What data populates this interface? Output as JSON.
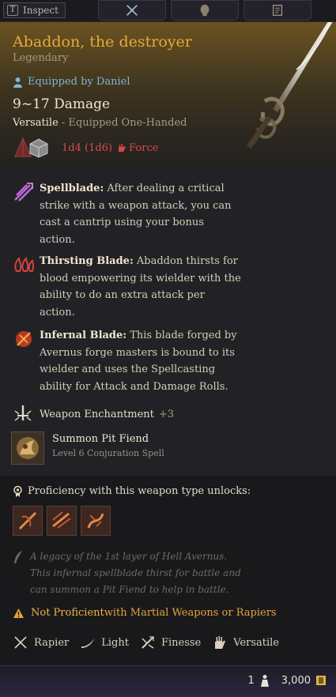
{
  "topbar": {
    "inspect_key": "T",
    "inspect_label": "Inspect",
    "tabs": [
      {
        "icon": "crossed-axes-icon"
      },
      {
        "icon": "character-head-icon"
      },
      {
        "icon": "journal-icon"
      }
    ]
  },
  "item": {
    "name": "Abaddon, the destroyer",
    "rarity": "Legendary",
    "equipped_by": "Equipped by Daniel",
    "damage": "9~17 Damage",
    "handedness_type": "Versatile",
    "handedness_state": " - Equipped One-Handed",
    "extra_damage": "1d4 (1d6)",
    "damage_type": "Force",
    "colors": {
      "title": "#e8a93a",
      "force": "#d84a4a",
      "equipped": "#7fb6d6"
    }
  },
  "passives": [
    {
      "name": "Spellblade:",
      "text": " After dealing a critical strike with a weapon attack, you can cast a cantrip using your bonus action.",
      "icon": "spellblade-icon"
    },
    {
      "name": "Thirsting Blade:",
      "text": " Abaddon thirsts for blood empowering its wielder with the ability to do an extra attack per action.",
      "icon": "thirsting-blade-icon"
    },
    {
      "name": "Infernal Blade:",
      "text": " This blade forged by Avernus forge masters is bound to its wielder and uses the Spellcasting ability for Attack and Damage Rolls.",
      "icon": "infernal-blade-icon"
    }
  ],
  "enchantment": {
    "label": "Weapon Enchantment",
    "value": "+3"
  },
  "spell": {
    "name": "Summon Pit Fiend",
    "level": "Level 6 Conjuration Spell"
  },
  "proficiency": {
    "title": "Proficiency with this weapon type unlocks:",
    "skills": [
      "slash-skill-icon",
      "cleave-skill-icon",
      "flourish-skill-icon"
    ]
  },
  "lore": {
    "line1": "A legacy of the 1st layer of Hell Avernus.",
    "line2": "This infernal spellblade thirst for battle and",
    "line3": "can summon a Pit Fiend to help in battle."
  },
  "warning": {
    "not": "Not Proficient",
    "rest": " with Martial Weapons or Rapiers"
  },
  "properties": [
    {
      "label": "Rapier",
      "icon": "rapier-icon"
    },
    {
      "label": "Light",
      "icon": "light-icon"
    },
    {
      "label": "Finesse",
      "icon": "finesse-icon"
    },
    {
      "label": "Versatile",
      "icon": "versatile-icon"
    }
  ],
  "footer": {
    "weight": "1",
    "value": "3,000"
  }
}
